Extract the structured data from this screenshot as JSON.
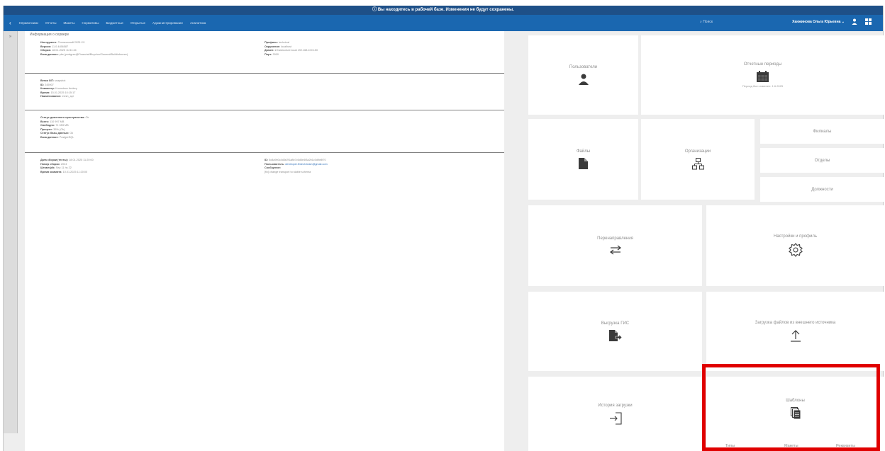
{
  "window": {
    "banner": "ⓘ Вы находитесь в рабочей базе. Изменения не будут сохранены.",
    "back_glyph": "‹",
    "menu_items": [
      "Справочники",
      "Отчеты",
      "Макеты",
      "Нормативы",
      "Бюджетные",
      "Открытые",
      "Администрирование",
      "Аналитика"
    ],
    "search_placeholder": "⌕ Поиск",
    "user_name": "Ханжинова Ольга Юрьевна ⌄",
    "icons": [
      "user-icon",
      "gear-icon"
    ]
  },
  "left_strip": {
    "toggle_glyph": "»"
  },
  "info": {
    "title": "Информация о сервере",
    "sections": [
      {
        "left": [
          {
            "k": "Инструмент:",
            "v": "Технический 2025 ХХ"
          },
          {
            "k": "Версия:",
            "v": "11.0.4456587"
          },
          {
            "k": "Сборка:",
            "v": "18.01.2025 11:51:46"
          },
          {
            "k": "База данных:",
            "v": "pbs (postgres@Financial/Bicyclon/General/Buildinformer)"
          }
        ],
        "right": [
          {
            "k": "Профиль:",
            "v": "technical"
          },
          {
            "k": "Окружение:",
            "v": "localhost"
          },
          {
            "k": "Домен:",
            "v": "infrastructure.local 192.168.100.150"
          },
          {
            "k": "Порт:",
            "v": "3000"
          }
        ]
      },
      {
        "left": [
          {
            "k": "Ветка GIT:",
            "v": "snapshot"
          },
          {
            "k": "ID:",
            "v": "245907"
          },
          {
            "k": "Коммитер:",
            "v": "Kuznetsov Andrey"
          },
          {
            "k": "Время:",
            "v": "15.01.2025 10:15:17"
          },
          {
            "k": "Наименование:",
            "v": "mesh_api"
          }
        ]
      },
      {
        "left": [
          {
            "k": "Статус доменного пространства:",
            "v": "Ok"
          },
          {
            "k": "Всего:",
            "v": "110 997 MB"
          },
          {
            "k": "Свободно:",
            "v": "71 653 MB"
          },
          {
            "k": "Процент:",
            "v": "35% (Ok)"
          },
          {
            "k": "Статус базы данных:",
            "v": "Ok"
          },
          {
            "k": "База данных:",
            "v": "PostgreSQL"
          }
        ]
      },
      {
        "left": [
          {
            "k": "Дата сборки (тесты):",
            "v": "18.01.2025 11:20:00"
          },
          {
            "k": "Номер сборки:",
            "v": "2024"
          },
          {
            "k": "Штамп jdk:",
            "v": "Sep 11 hs 22"
          },
          {
            "k": "Время коммита:",
            "v": "10.01.2025 11:20:00"
          }
        ],
        "right": [
          {
            "k": "ID:",
            "v": "5c8a9b0c4d3e2f1a8b7c6d5e4f3a2b1c0d9e8f70"
          },
          {
            "k": "Пользователь:",
            "v": "developer.fintech.team@gmail.com"
          },
          {
            "k": "Сообщение:",
            "v": ""
          },
          {
            "k": "",
            "v": "[fix] change transport to stable schema"
          }
        ]
      }
    ]
  },
  "tiles": {
    "users": {
      "label": "Пользователи"
    },
    "periods": {
      "label": "Отчетные периоды",
      "sub": "Период был изменен: 1.6.2025"
    },
    "files": {
      "label": "Файлы"
    },
    "organizations": {
      "label": "Организации"
    },
    "filials": {
      "label": "Филиалы"
    },
    "departments": {
      "label": "Отделы"
    },
    "positions": {
      "label": "Должности"
    },
    "redirects": {
      "label": "Перенаправления"
    },
    "settings": {
      "label": "Настройки и профиль"
    },
    "gis_upload": {
      "label": "Выгрузка ГИС"
    },
    "external_upload": {
      "label": "Загрузка файлов из внешнего источника"
    },
    "upload_history": {
      "label": "История загрузки"
    },
    "templates": {
      "label": "Шаблоны",
      "sub_left": "Типы",
      "sub_mid": "Макеты",
      "sub_right": "Реквизиты"
    }
  },
  "colors": {
    "banner": "#1e5088",
    "menubar": "#1a67b0",
    "highlight": "#e00000",
    "icon_dark": "#3a3a3a"
  }
}
